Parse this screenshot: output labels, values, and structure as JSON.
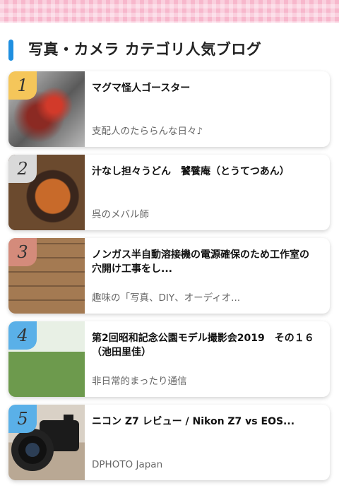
{
  "heading": "写真・カメラ カテゴリ人気ブログ",
  "items": [
    {
      "rank": "1",
      "rank_color": "#f5c65a",
      "title": "マグマ怪人ゴースター",
      "author": "支配人のたららんな日々♪",
      "thumb": "monster-figure-image"
    },
    {
      "rank": "2",
      "rank_color": "#d9d9d9",
      "title": "汁なし担々うどん　饕餮庵（とうてつあん）",
      "author": "呉のメバル師",
      "thumb": "noodle-bowl-image"
    },
    {
      "rank": "3",
      "rank_color": "#d48b7b",
      "title": "ノンガス半自動溶接機の電源確保のため工作室の穴開け工事をし...",
      "author": "趣味の「写真、DIY、オーディオ...",
      "thumb": "wood-wall-image"
    },
    {
      "rank": "4",
      "rank_color": "#5ab0e8",
      "title": "第2回昭和記念公園モデル撮影会2019　その１６（池田里佳）",
      "author": "非日常的まったり通信",
      "thumb": "model-portrait-image"
    },
    {
      "rank": "5",
      "rank_color": "#5ab0e8",
      "title": "ニコン Z7 レビュー / Nikon Z7 vs EOS...",
      "author": "DPHOTO Japan",
      "thumb": "camera-lens-image"
    }
  ]
}
